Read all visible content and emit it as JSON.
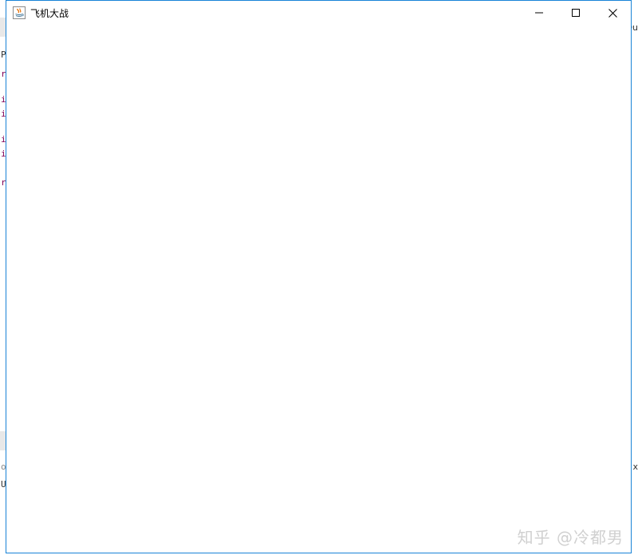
{
  "window": {
    "title": "飞机大战",
    "app_icon": "java-icon",
    "controls": {
      "minimize_icon": "minimize-icon",
      "maximize_icon": "maximize-icon",
      "close_icon": "close-icon"
    },
    "border_color": "#1883d7"
  },
  "background": {
    "fragments_left": [
      "r",
      "i",
      "i",
      "i",
      "i",
      "r"
    ],
    "fragment_top": "P",
    "fragments_right": [
      "Qu",
      "x"
    ],
    "fragment_bottom": "U",
    "fragment_lower": "o"
  },
  "watermark": {
    "text": "知乎 @冷都男"
  }
}
